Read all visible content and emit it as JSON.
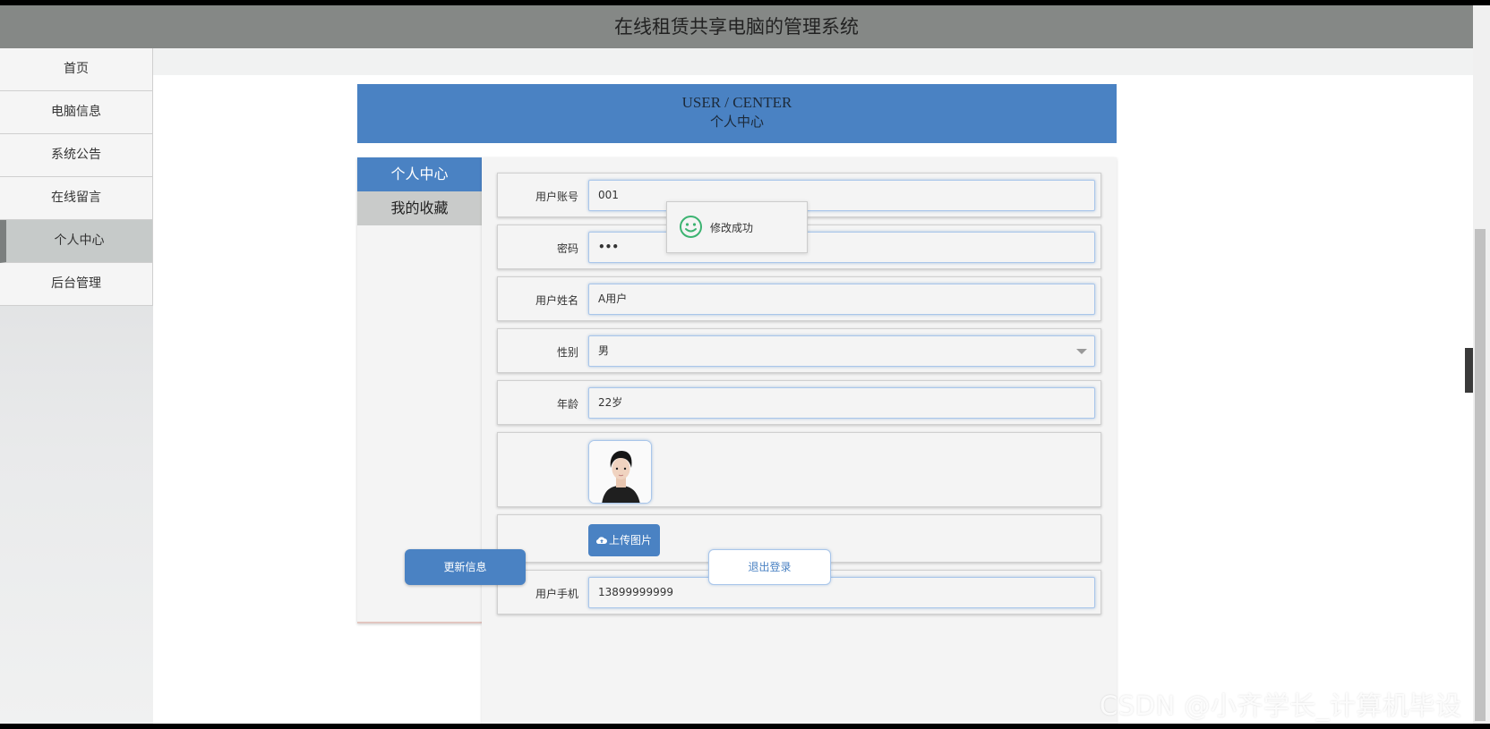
{
  "app": {
    "title": "在线租赁共享电脑的管理系统"
  },
  "sidebar": {
    "items": [
      {
        "label": "首页"
      },
      {
        "label": "电脑信息"
      },
      {
        "label": "系统公告"
      },
      {
        "label": "在线留言"
      },
      {
        "label": "个人中心",
        "active": true
      },
      {
        "label": "后台管理"
      }
    ]
  },
  "header": {
    "en": "USER / CENTER",
    "cn": "个人中心"
  },
  "tabs": [
    {
      "label": "个人中心",
      "active": true
    },
    {
      "label": "我的收藏"
    }
  ],
  "form": {
    "account": {
      "label": "用户账号",
      "value": "001"
    },
    "password": {
      "label": "密码",
      "value": "•••"
    },
    "name": {
      "label": "用户姓名",
      "value": "A用户"
    },
    "gender": {
      "label": "性别",
      "value": "男"
    },
    "age": {
      "label": "年龄",
      "value": "22岁"
    },
    "upload_label": "上传图片",
    "phone": {
      "label": "用户手机",
      "value": "13899999999"
    }
  },
  "buttons": {
    "update": "更新信息",
    "logout": "退出登录"
  },
  "toast": {
    "text": "修改成功"
  },
  "side_arrow": "›",
  "watermark": "CSDN @小齐学长_计算机毕设",
  "colors": {
    "accent": "#4a82c3",
    "topbar": "#858886",
    "toast_icon": "#3cb371"
  }
}
